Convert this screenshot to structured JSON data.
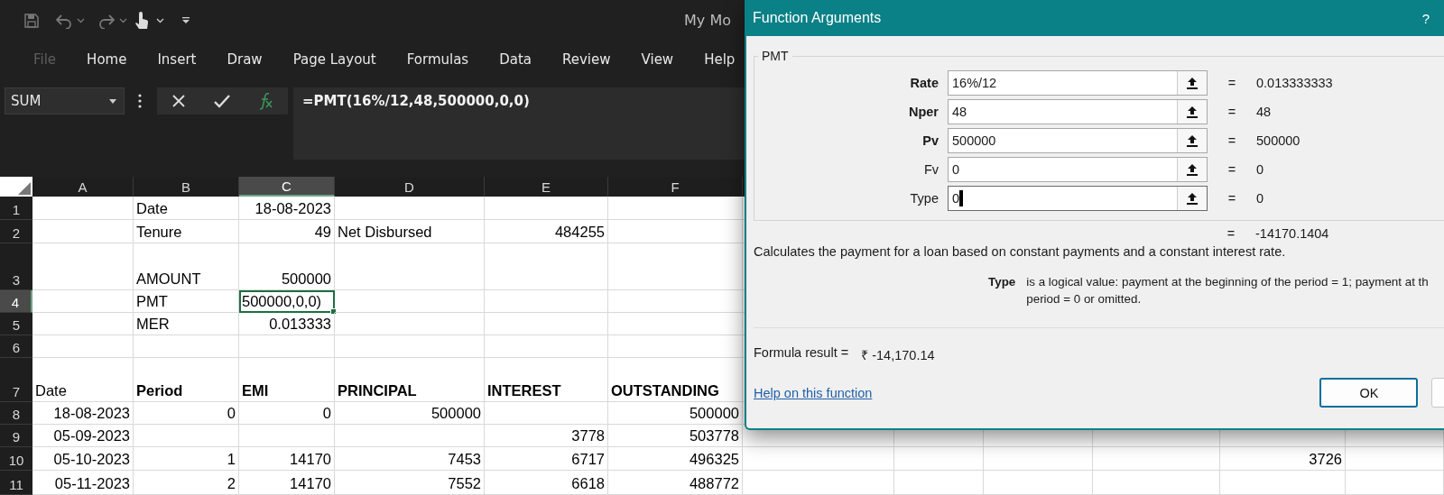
{
  "window": {
    "title": "My Mo"
  },
  "ribbon_tabs": [
    {
      "label": "File",
      "disabled": true
    },
    {
      "label": "Home",
      "disabled": false
    },
    {
      "label": "Insert",
      "disabled": false
    },
    {
      "label": "Draw",
      "disabled": false
    },
    {
      "label": "Page Layout",
      "disabled": false
    },
    {
      "label": "Formulas",
      "disabled": false
    },
    {
      "label": "Data",
      "disabled": false
    },
    {
      "label": "Review",
      "disabled": false
    },
    {
      "label": "View",
      "disabled": false
    },
    {
      "label": "Help",
      "disabled": false
    }
  ],
  "name_box": {
    "value": "SUM"
  },
  "formula_bar": {
    "value": "=PMT(16%/12,48,500000,0,0)"
  },
  "sheet": {
    "columns": [
      {
        "label": "A",
        "selected": false
      },
      {
        "label": "B",
        "selected": false
      },
      {
        "label": "C",
        "selected": true
      },
      {
        "label": "D",
        "selected": false
      },
      {
        "label": "E",
        "selected": false
      },
      {
        "label": "F",
        "selected": false
      }
    ],
    "rows": [
      {
        "label": "1",
        "selected": false,
        "cells": [
          null,
          {
            "text": "Date",
            "kind": "text"
          },
          {
            "text": "18-08-2023",
            "kind": "number"
          },
          null,
          null,
          null,
          null,
          null,
          null,
          null,
          null,
          null
        ]
      },
      {
        "label": "2",
        "selected": false,
        "cells": [
          null,
          {
            "text": "Tenure",
            "kind": "text"
          },
          {
            "text": "49",
            "kind": "number"
          },
          {
            "text": "Net Disbursed",
            "kind": "text"
          },
          {
            "text": "484255",
            "kind": "number"
          },
          null,
          null,
          null,
          null,
          null,
          null,
          null
        ]
      },
      {
        "label": "3",
        "selected": false,
        "cells": [
          null,
          {
            "text": "AMOUNT",
            "kind": "text"
          },
          {
            "text": "500000",
            "kind": "number"
          },
          null,
          null,
          null,
          null,
          null,
          null,
          null,
          null,
          null
        ]
      },
      {
        "label": "4",
        "selected": true,
        "cells": [
          null,
          {
            "text": "PMT",
            "kind": "text"
          },
          {
            "text": "500000,0,0)",
            "kind": "text"
          },
          null,
          null,
          null,
          null,
          null,
          null,
          null,
          null,
          null
        ]
      },
      {
        "label": "5",
        "selected": false,
        "cells": [
          null,
          {
            "text": "MER",
            "kind": "text"
          },
          {
            "text": "0.013333",
            "kind": "number"
          },
          null,
          null,
          null,
          null,
          null,
          null,
          null,
          null,
          null
        ]
      },
      {
        "label": "6",
        "selected": false,
        "cells": [
          null,
          null,
          null,
          null,
          null,
          null,
          null,
          null,
          null,
          null,
          null,
          null
        ]
      },
      {
        "label": "7",
        "selected": false,
        "cells": [
          {
            "text": "Date",
            "kind": "text"
          },
          {
            "text": "Period",
            "kind": "heading"
          },
          {
            "text": "EMI",
            "kind": "heading"
          },
          {
            "text": "PRINCIPAL",
            "kind": "heading"
          },
          {
            "text": "INTEREST",
            "kind": "heading"
          },
          {
            "text": "OUTSTANDING",
            "kind": "heading"
          },
          null,
          null,
          null,
          null,
          null,
          null
        ]
      },
      {
        "label": "8",
        "selected": false,
        "cells": [
          {
            "text": "18-08-2023",
            "kind": "number"
          },
          {
            "text": "0",
            "kind": "number"
          },
          {
            "text": "0",
            "kind": "number"
          },
          {
            "text": "500000",
            "kind": "number"
          },
          null,
          {
            "text": "500000",
            "kind": "number"
          },
          null,
          null,
          null,
          null,
          null,
          null
        ]
      },
      {
        "label": "9",
        "selected": false,
        "cells": [
          {
            "text": "05-09-2023",
            "kind": "number"
          },
          null,
          null,
          null,
          {
            "text": "3778",
            "kind": "number"
          },
          {
            "text": "503778",
            "kind": "number"
          },
          null,
          null,
          null,
          null,
          null,
          null
        ]
      },
      {
        "label": "10",
        "selected": false,
        "cells": [
          {
            "text": "05-10-2023",
            "kind": "number"
          },
          {
            "text": "1",
            "kind": "number"
          },
          {
            "text": "14170",
            "kind": "number"
          },
          {
            "text": "7453",
            "kind": "number"
          },
          {
            "text": "6717",
            "kind": "number"
          },
          {
            "text": "496325",
            "kind": "number"
          },
          null,
          null,
          null,
          null,
          {
            "text": "3726",
            "kind": "number"
          },
          null
        ]
      },
      {
        "label": "11",
        "selected": false,
        "cells": [
          {
            "text": "05-11-2023",
            "kind": "number"
          },
          {
            "text": "2",
            "kind": "number"
          },
          {
            "text": "14170",
            "kind": "number"
          },
          {
            "text": "7552",
            "kind": "number"
          },
          {
            "text": "6618",
            "kind": "number"
          },
          {
            "text": "488772",
            "kind": "number"
          },
          null,
          null,
          null,
          null,
          null,
          null
        ]
      }
    ]
  },
  "dialog": {
    "title": "Function Arguments",
    "help_mark": "?",
    "group": "PMT",
    "arguments": [
      {
        "name": "Rate",
        "required": true,
        "value": "16%/12",
        "eq": "=",
        "result": "0.013333333",
        "focused": false
      },
      {
        "name": "Nper",
        "required": true,
        "value": "48",
        "eq": "=",
        "result": "48",
        "focused": false
      },
      {
        "name": "Pv",
        "required": true,
        "value": "500000",
        "eq": "=",
        "result": "500000",
        "focused": false
      },
      {
        "name": "Fv",
        "required": false,
        "value": "0",
        "eq": "=",
        "result": "0",
        "focused": false
      },
      {
        "name": "Type",
        "required": false,
        "value": "0",
        "eq": "=",
        "result": "0",
        "focused": true
      }
    ],
    "result_eq": "=",
    "result": "-14170.1404",
    "description": "Calculates the payment for a loan based on constant payments and a constant interest rate.",
    "argument_help": {
      "name": "Type",
      "lines": [
        "is a logical value: payment at the beginning of the period = 1; payment at th",
        "period = 0 or omitted."
      ]
    },
    "formula_result_label": "Formula result =",
    "formula_result": "₹ -14,170.14",
    "help_link": "Help on this function",
    "buttons": [
      {
        "label": "OK"
      }
    ]
  }
}
